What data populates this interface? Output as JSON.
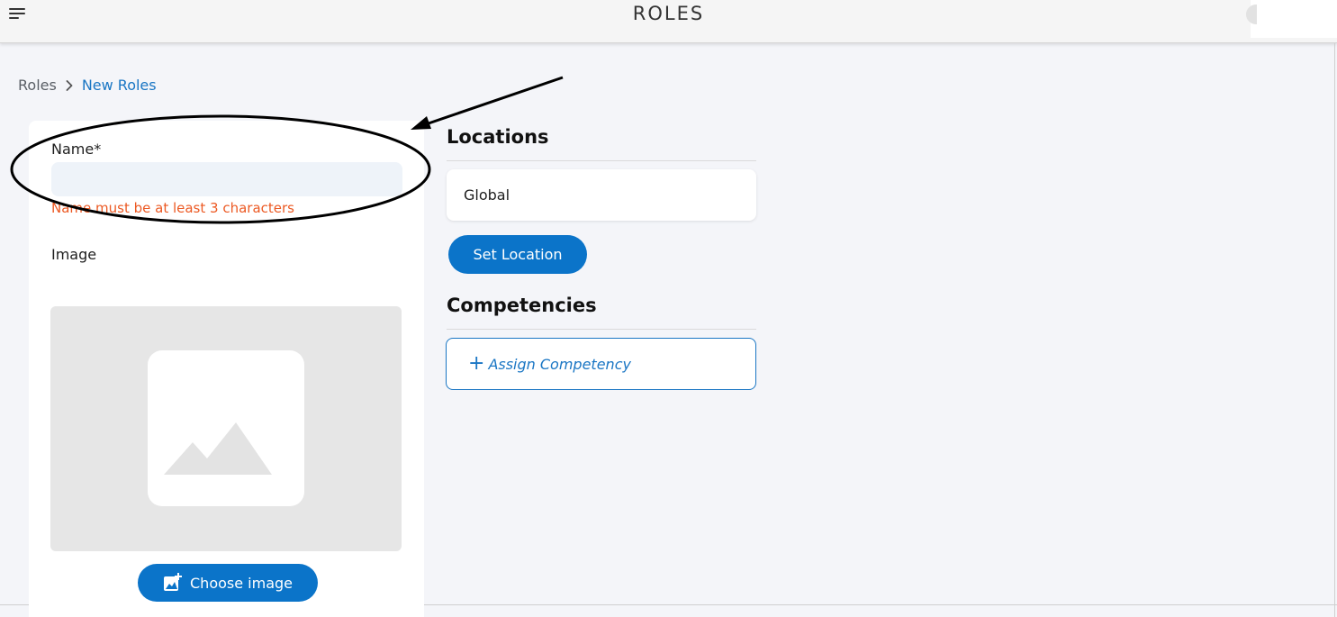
{
  "header": {
    "title": "ROLES",
    "menu_icon": "hamburger-menu-icon"
  },
  "breadcrumb": {
    "root": "Roles",
    "current": "New Roles",
    "separator_icon": "chevron-right-icon"
  },
  "form": {
    "name_label": "Name*",
    "name_value": "",
    "name_error": "Name must be at least 3 characters",
    "image_label": "Image",
    "image_placeholder_icon": "image-placeholder-icon",
    "choose_image_label": "Choose image",
    "choose_image_icon": "add-photo-icon"
  },
  "locations": {
    "title": "Locations",
    "items": [
      "Global"
    ],
    "set_location_label": "Set Location"
  },
  "competencies": {
    "title": "Competencies",
    "assign_label": "Assign Competency",
    "assign_icon": "plus-icon"
  },
  "colors": {
    "primary": "#0b74c9",
    "link": "#1a76c4",
    "error": "#ec5a24",
    "background": "#f4f5f9"
  }
}
